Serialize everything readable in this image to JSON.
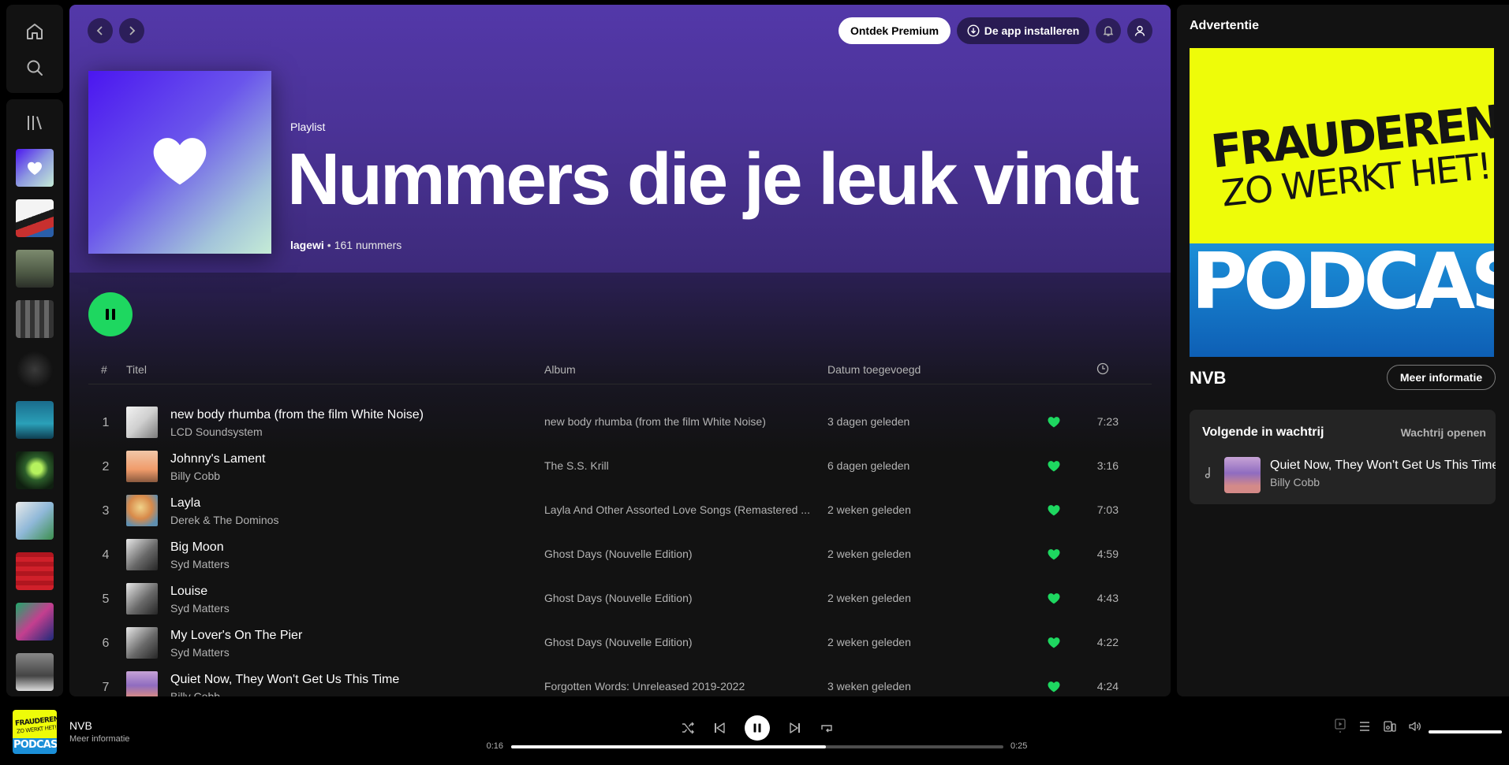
{
  "nav": {
    "home_icon": "home-icon",
    "search_icon": "search-icon",
    "library_icon": "library-icon"
  },
  "header": {
    "premium_label": "Ontdek Premium",
    "install_label": "De app installeren"
  },
  "playlist": {
    "type": "Playlist",
    "title": "Nummers die je leuk vindt",
    "owner": "lagewi",
    "separator": "•",
    "count": "161 nummers"
  },
  "table": {
    "headers": {
      "num": "#",
      "title": "Titel",
      "album": "Album",
      "date": "Datum toegevoegd"
    },
    "tracks": [
      {
        "n": "1",
        "title": "new body rhumba (from the film White Noise)",
        "artist": "LCD Soundsystem",
        "album": "new body rhumba (from the film White Noise)",
        "date": "3 dagen geleden",
        "duration": "7:23"
      },
      {
        "n": "2",
        "title": "Johnny's Lament",
        "artist": "Billy Cobb",
        "album": "The S.S. Krill",
        "date": "6 dagen geleden",
        "duration": "3:16"
      },
      {
        "n": "3",
        "title": "Layla",
        "artist": "Derek & The Dominos",
        "album": "Layla And Other Assorted Love Songs (Remastered ...",
        "date": "2 weken geleden",
        "duration": "7:03"
      },
      {
        "n": "4",
        "title": "Big Moon",
        "artist": "Syd Matters",
        "album": "Ghost Days (Nouvelle Edition)",
        "date": "2 weken geleden",
        "duration": "4:59"
      },
      {
        "n": "5",
        "title": "Louise",
        "artist": "Syd Matters",
        "album": "Ghost Days (Nouvelle Edition)",
        "date": "2 weken geleden",
        "duration": "4:43"
      },
      {
        "n": "6",
        "title": "My Lover's On The Pier",
        "artist": "Syd Matters",
        "album": "Ghost Days (Nouvelle Edition)",
        "date": "2 weken geleden",
        "duration": "4:22"
      },
      {
        "n": "7",
        "title": "Quiet Now, They Won't Get Us This Time",
        "artist": "Billy Cobb",
        "album": "Forgotten Words: Unreleased 2019-2022",
        "date": "3 weken geleden",
        "duration": "4:24"
      }
    ]
  },
  "right_panel": {
    "title": "Advertentie",
    "ad_line1": "FRAUDEREN",
    "ad_line2": "ZO WERKT HET!",
    "ad_line3": "PODCAST",
    "ad_name": "NVB",
    "more_label": "Meer informatie",
    "queue_title": "Volgende in wachtrij",
    "queue_open": "Wachtrij openen",
    "queue_track": "Quiet Now, They Won't Get Us This Time",
    "queue_artist": "Billy Cobb"
  },
  "player": {
    "art_line1": "FRAUDEREN",
    "art_line2": "ZO WERKT HET!",
    "art_line3": "PODCAST",
    "title": "NVB",
    "subtitle": "Meer informatie",
    "current": "0:16",
    "total": "0:25",
    "progress": 0.64,
    "volume": 1.0
  },
  "colors": {
    "accent": "#1ed760",
    "hero": "#5338a9",
    "background": "#121212"
  }
}
